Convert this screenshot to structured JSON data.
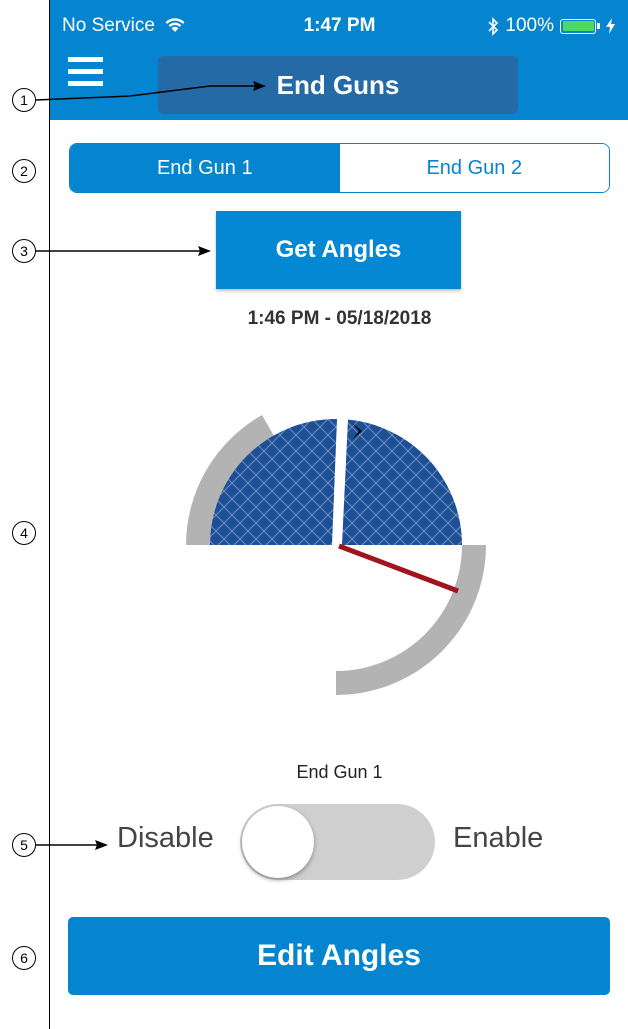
{
  "status_bar": {
    "carrier": "No Service",
    "time": "1:47 PM",
    "battery": "100%",
    "battery_level": 1.0
  },
  "header": {
    "title": "End Guns",
    "menu_icon": "hamburger-menu-icon"
  },
  "segments": [
    {
      "label": "End Gun 1",
      "selected": true
    },
    {
      "label": "End Gun 2",
      "selected": false
    }
  ],
  "get_angles": {
    "label": "Get Angles",
    "timestamp": "1:46 PM - 05/18/2018"
  },
  "end_gun": {
    "name": "End Gun 1",
    "toggle_off_label": "Disable",
    "toggle_on_label": "Enable",
    "enabled": false
  },
  "edit_angles": {
    "label": "Edit Angles"
  },
  "callouts": [
    "1",
    "2",
    "3",
    "4",
    "5",
    "6"
  ],
  "colors": {
    "primary": "#0585cf",
    "title_button": "#236aa6",
    "coverage_fill": "#1d4f96",
    "arc_gray": "#b3b3b3",
    "pointer_red": "#a0141e"
  }
}
